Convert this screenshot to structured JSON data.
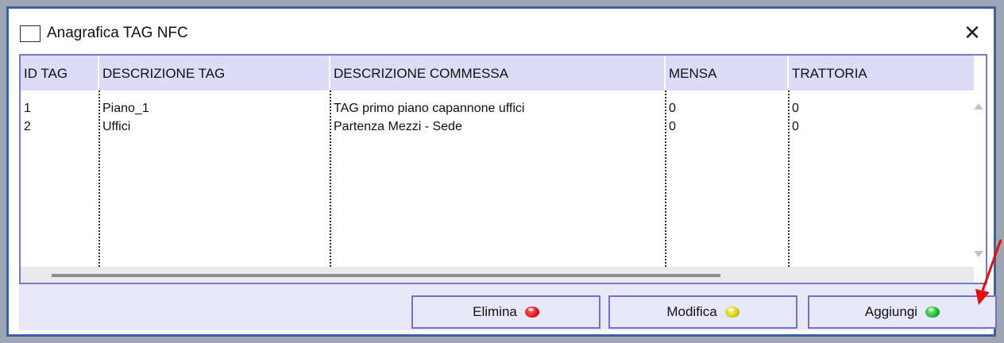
{
  "window": {
    "title": "Anagrafica TAG NFC",
    "close_symbol": "✕",
    "app_icon": "window-icon",
    "close_icon": "close-icon"
  },
  "table": {
    "columns": [
      "ID TAG",
      "DESCRIZIONE TAG",
      "DESCRIZIONE COMMESSA",
      "MENSA",
      "TRATTORIA"
    ],
    "rows": [
      [
        "1",
        "Piano_1",
        "TAG primo piano capannone uffici",
        "0",
        "0"
      ],
      [
        "2",
        "Uffici",
        "Partenza Mezzi - Sede",
        "0",
        "0"
      ]
    ]
  },
  "buttons": {
    "delete": {
      "label": "Elimina",
      "led_color": "#e0141b",
      "icon": "red-led-icon"
    },
    "edit": {
      "label": "Modifica",
      "led_color": "#d8cc10",
      "icon": "yellow-led-icon"
    },
    "add": {
      "label": "Aggiungi",
      "led_color": "#1db52a",
      "icon": "green-led-icon"
    }
  },
  "colors": {
    "window_border": "#3b62a8",
    "header_bg": "#dcdcf8",
    "button_border": "#6f73cc",
    "annotation_arrow": "#e01010"
  }
}
